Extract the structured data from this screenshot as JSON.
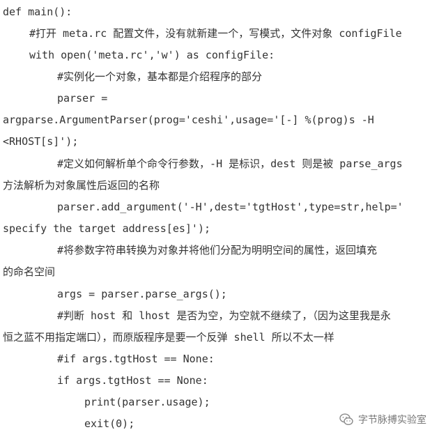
{
  "code": {
    "lines": [
      "def main():",
      "#打开 meta.rc 配置文件，没有就新建一个，写模式，文件对象 configFile",
      "with open('meta.rc','w') as configFile:",
      "#实例化一个对象，基本都是介绍程序的部分",
      "parser =",
      "argparse.ArgumentParser(prog='ceshi',usage='[-] %(prog)s -H",
      "<RHOST[s]');",
      "#定义如何解析单个命令行参数，-H 是标识，dest 则是被 parse_args",
      "方法解析为对象属性后返回的名称",
      "parser.add_argument('-H',dest='tgtHost',type=str,help='",
      "specify the target address[es]');",
      "#将参数字符串转换为对象并将他们分配为明明空间的属性，返回填充",
      "的命名空间",
      "args = parser.parse_args();",
      "#判断 host 和 lhost 是否为空，为空就不继续了，（因为这里我是永",
      "恒之蓝不用指定端口），而原版程序是要一个反弹 shell 所以不太一样",
      "#if args.tgtHost == None:",
      "if args.tgtHost == None:",
      "print(parser.usage);",
      "exit(0);"
    ]
  },
  "watermark": {
    "text": "字节脉搏实验室",
    "icon": "wechat-icon"
  }
}
